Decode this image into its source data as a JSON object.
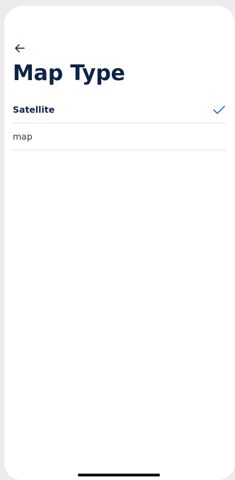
{
  "page": {
    "title": "Map Type"
  },
  "map_types": {
    "options": [
      {
        "label": "Satellite",
        "selected": true
      },
      {
        "label": "map",
        "selected": false
      }
    ]
  },
  "icons": {
    "back": "arrow-left-icon",
    "selected": "checkmark-icon"
  },
  "colors": {
    "title": "#0e2446",
    "accent": "#2f6fd0",
    "divider": "#e4e4e6",
    "background": "#ececef"
  }
}
